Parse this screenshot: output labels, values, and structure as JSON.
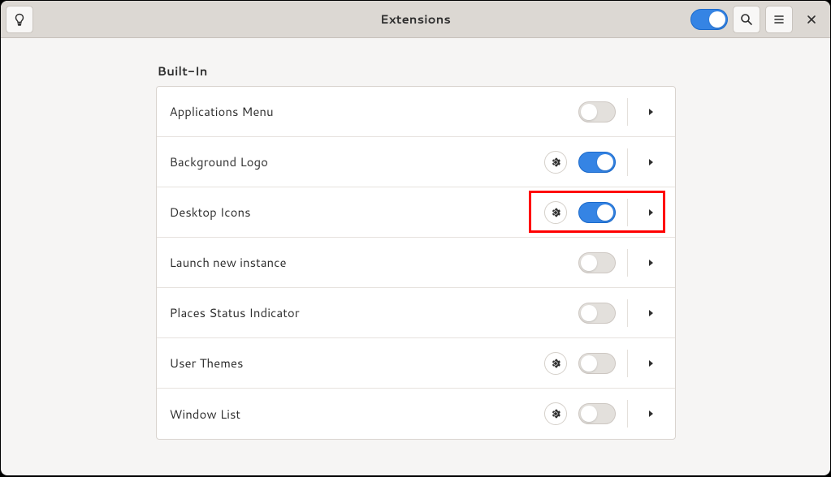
{
  "header": {
    "title": "Extensions",
    "global_toggle_on": true
  },
  "section_title": "Built-In",
  "extensions": [
    {
      "name": "Applications Menu",
      "enabled": false,
      "has_settings": false
    },
    {
      "name": "Background Logo",
      "enabled": true,
      "has_settings": true
    },
    {
      "name": "Desktop Icons",
      "enabled": true,
      "has_settings": true,
      "highlighted": true
    },
    {
      "name": "Launch new instance",
      "enabled": false,
      "has_settings": false
    },
    {
      "name": "Places Status Indicator",
      "enabled": false,
      "has_settings": false
    },
    {
      "name": "User Themes",
      "enabled": false,
      "has_settings": true
    },
    {
      "name": "Window List",
      "enabled": false,
      "has_settings": true
    }
  ]
}
